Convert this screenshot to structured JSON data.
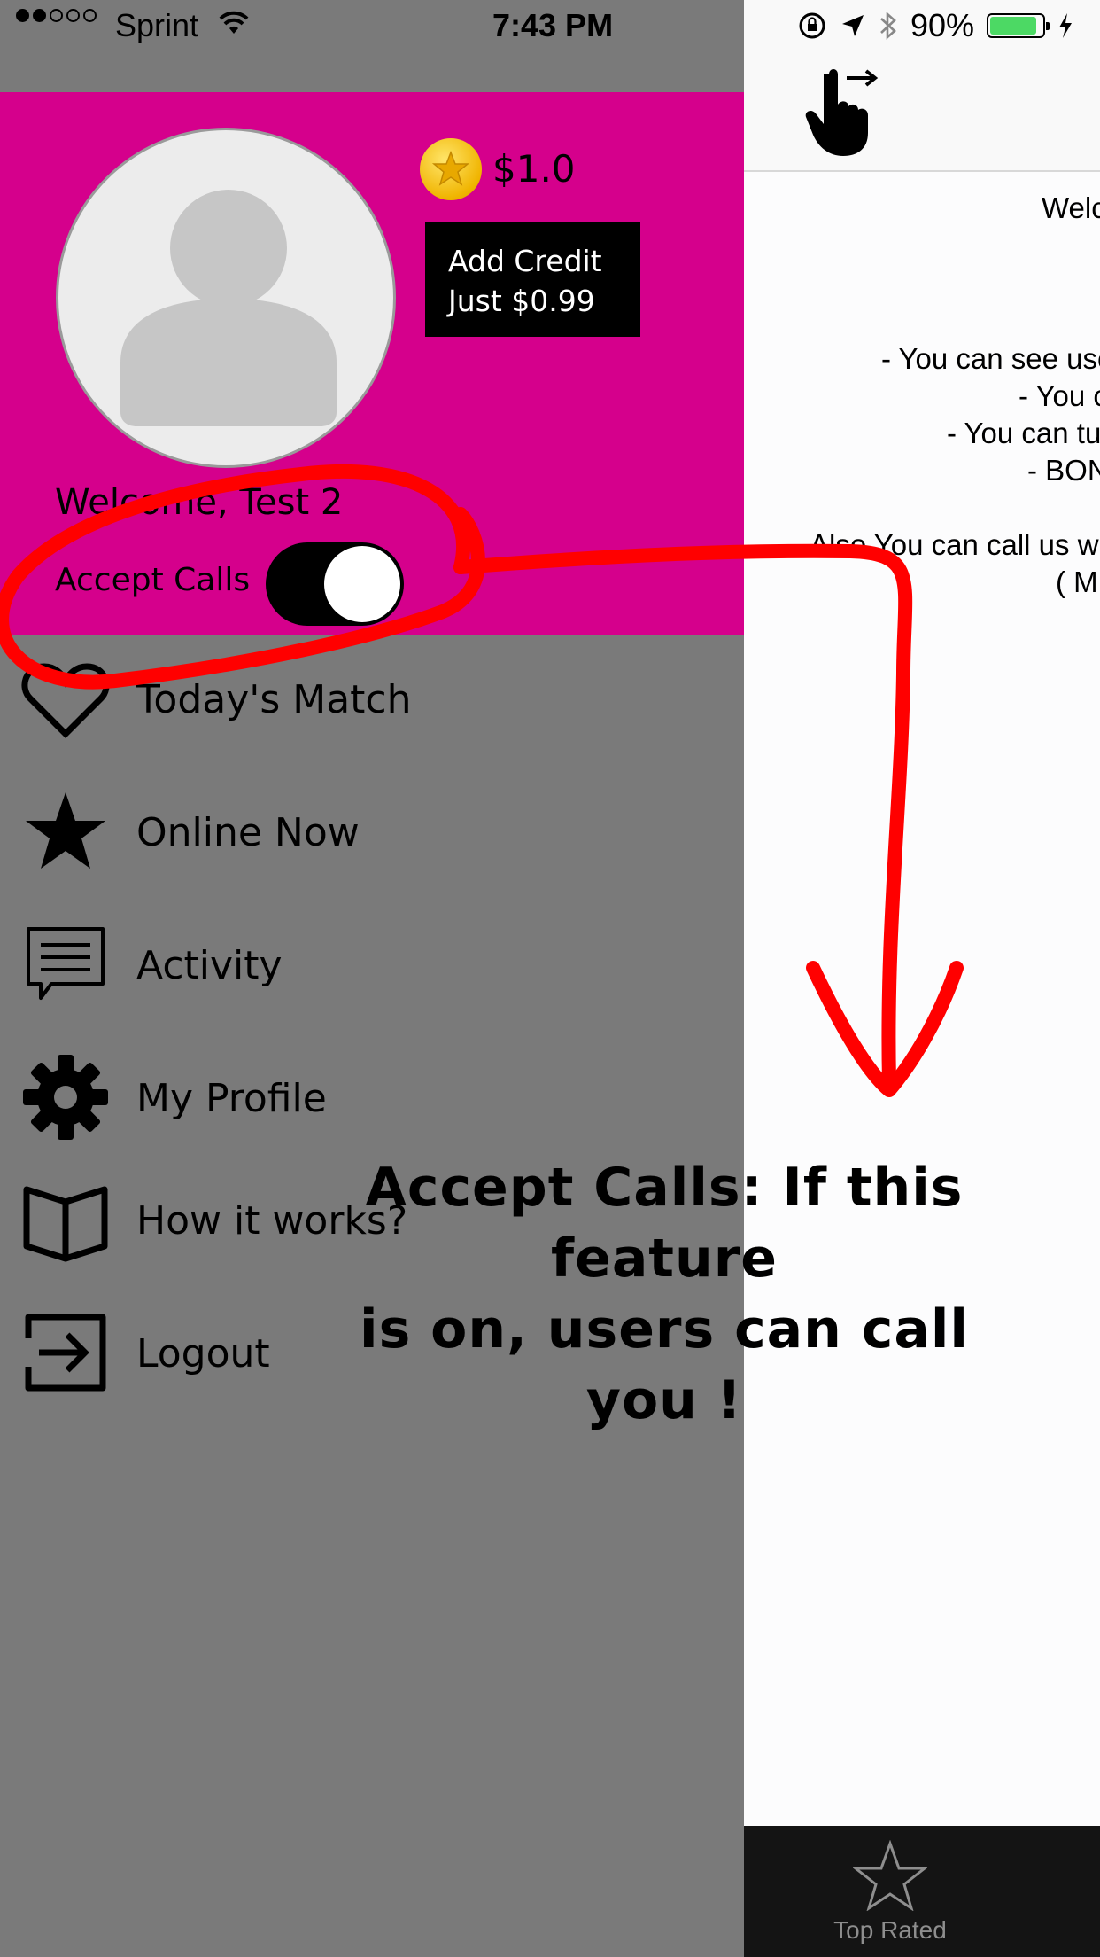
{
  "status_bar": {
    "carrier": "Sprint",
    "time": "7:43 PM",
    "battery": "90%",
    "signal_dots_filled": 2,
    "signal_dots_total": 5,
    "battery_level": 0.9
  },
  "content": {
    "welcome_lines": [
      "Welc",
      "- You can see use",
      "- You c",
      "- You can tur",
      "- BON",
      "Also You can call us wit",
      "( M"
    ],
    "tab": {
      "label": "Top Rated",
      "icon": "star-outline-icon"
    }
  },
  "menu": {
    "balance": "$1.0",
    "add_credit": {
      "line1": "Add Credit",
      "line2": "Just $0.99"
    },
    "welcome": "Welcome, Test 2",
    "accept_calls": {
      "label": "Accept Calls",
      "on": true
    },
    "items": [
      {
        "label": "Today's Match",
        "icon": "heart-icon"
      },
      {
        "label": "Online Now",
        "icon": "star-icon"
      },
      {
        "label": "Activity",
        "icon": "chat-bubble-icon"
      },
      {
        "label": "My Profile",
        "icon": "gear-icon"
      },
      {
        "label": "How it works?",
        "icon": "book-icon"
      },
      {
        "label": "Logout",
        "icon": "logout-icon"
      }
    ]
  },
  "annotation": {
    "line1": "Accept Calls: If this feature",
    "line2": "is on, users can call you !",
    "color": "#ff0000"
  },
  "colors": {
    "header_magenta": "#d5008c",
    "menu_gray": "#7a7a7a",
    "tab_bar": "#141414"
  }
}
